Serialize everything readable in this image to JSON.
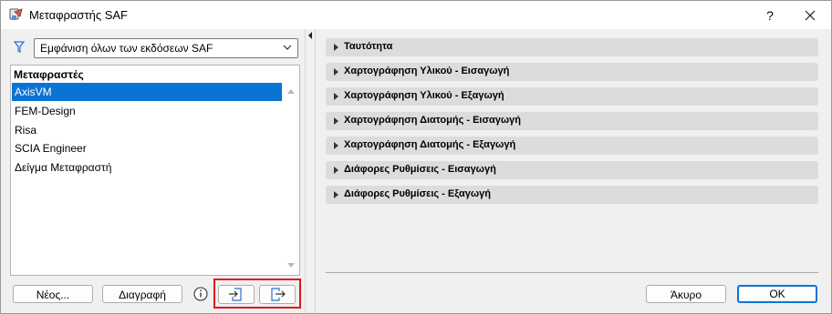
{
  "window": {
    "title": "Μεταφραστής SAF",
    "help": "?"
  },
  "filter": {
    "selected": "Εμφάνιση όλων των εκδόσεων SAF"
  },
  "list": {
    "header": "Μεταφραστές",
    "items": [
      "AxisVM",
      "FEM-Design",
      "Risa",
      "SCIA Engineer",
      "Δείγμα Μεταφραστή"
    ],
    "selected_index": 0
  },
  "buttons": {
    "new": "Νέος...",
    "delete": "Διαγραφή",
    "cancel": "Άκυρο",
    "ok": "ΟΚ"
  },
  "sections": [
    "Ταυτότητα",
    "Χαρτογράφηση Υλικού - Εισαγωγή",
    "Χαρτογράφηση Υλικού - Εξαγωγή",
    "Χαρτογράφηση Διατομής - Εισαγωγή",
    "Χαρτογράφηση Διατομής - Εξαγωγή",
    "Διάφορες Ρυθμίσεις - Εισαγωγή",
    "Διάφορες Ρυθμίσεις - Εξαγωγή"
  ],
  "colors": {
    "selection": "#0a74d4",
    "highlight": "#e0141c",
    "filter_icon": "#2a6fd6"
  }
}
